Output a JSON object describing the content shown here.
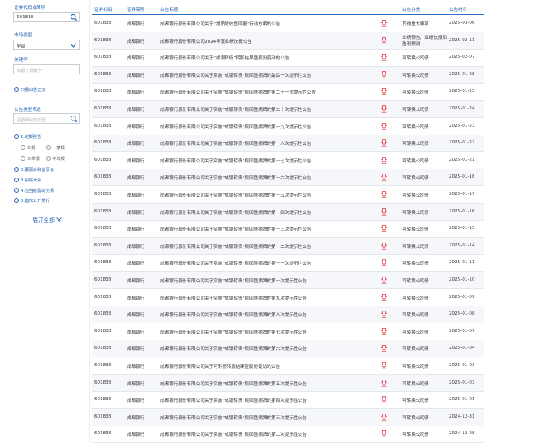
{
  "filters": {
    "code_label": "证券代码或简称",
    "code_value": "601838",
    "market_label": "市场类型",
    "market_value": "全部",
    "keyword_label": "关键字",
    "keyword_placeholder": "标题 / 关键字",
    "only_body_label": "只看公告正文",
    "category_label": "公告类型筛选",
    "category_placeholder": "请选择公告类型",
    "categories": [
      {
        "label": "1.定期报告"
      },
      {
        "label": "2.董事会和监事会"
      },
      {
        "label": "3.股东大会"
      },
      {
        "label": "4.应当披露的交易"
      },
      {
        "label": "5.首次公开发行"
      }
    ],
    "periodic_sub": [
      "年报",
      "一季报",
      "三季报",
      "半年报"
    ],
    "expand_label": "展开全部"
  },
  "table": {
    "headers": [
      "证券代码",
      "证券简称",
      "公告标题",
      "公告分类",
      "公告时间"
    ],
    "rows": [
      {
        "code": "601838",
        "name": "成都银行",
        "title": "成都银行股份有限公司关于“提质增效重回报”行动方案的公告",
        "type": "其他重大事项",
        "date": "2025-03-06"
      },
      {
        "code": "601838",
        "name": "成都银行",
        "title": "成都银行股份有限公司2024年度业绩快报公告",
        "type": "业绩预告、业绩快报和盈利预测",
        "date": "2025-02-11"
      },
      {
        "code": "601838",
        "name": "成都银行",
        "title": "成都银行股份有限公司关于“成银转债”转股结果暨股份变动的公告",
        "type": "可转换公司债",
        "date": "2025-02-07"
      },
      {
        "code": "601838",
        "name": "成都银行",
        "title": "成都银行股份有限公司关于实施“成银转债”赎回暨摘牌的最后一次提示性公告",
        "type": "可转换公司债",
        "date": "2025-01-28"
      },
      {
        "code": "601838",
        "name": "成都银行",
        "title": "成都银行股份有限公司关于实施“成银转债”赎回暨摘牌的第二十一次提示性公告",
        "type": "可转换公司债",
        "date": "2025-01-25"
      },
      {
        "code": "601838",
        "name": "成都银行",
        "title": "成都银行股份有限公司关于实施“成银转债”赎回暨摘牌的第二十次提示性公告",
        "type": "可转换公司债",
        "date": "2025-01-24"
      },
      {
        "code": "601838",
        "name": "成都银行",
        "title": "成都银行股份有限公司关于实施“成银转债”赎回暨摘牌的第十九次提示性公告",
        "type": "可转换公司债",
        "date": "2025-01-23"
      },
      {
        "code": "601838",
        "name": "成都银行",
        "title": "成都银行股份有限公司关于实施“成银转债”赎回暨摘牌的第十八次提示性公告",
        "type": "可转换公司债",
        "date": "2025-01-22"
      },
      {
        "code": "601838",
        "name": "成都银行",
        "title": "成都银行股份有限公司关于实施“成银转债”赎回暨摘牌的第十七次提示性公告",
        "type": "可转换公司债",
        "date": "2025-01-21"
      },
      {
        "code": "601838",
        "name": "成都银行",
        "title": "成都银行股份有限公司关于实施“成银转债”赎回暨摘牌的第十六次提示性公告",
        "type": "可转换公司债",
        "date": "2025-01-18"
      },
      {
        "code": "601838",
        "name": "成都银行",
        "title": "成都银行股份有限公司关于实施“成银转债”赎回暨摘牌的第十五次提示性公告",
        "type": "可转换公司债",
        "date": "2025-01-17"
      },
      {
        "code": "601838",
        "name": "成都银行",
        "title": "成都银行股份有限公司关于实施“成银转债”赎回暨摘牌的第十四次提示性公告",
        "type": "可转换公司债",
        "date": "2025-01-16"
      },
      {
        "code": "601838",
        "name": "成都银行",
        "title": "成都银行股份有限公司关于实施“成银转债”赎回暨摘牌的第十三次提示性公告",
        "type": "可转换公司债",
        "date": "2025-01-15"
      },
      {
        "code": "601838",
        "name": "成都银行",
        "title": "成都银行股份有限公司关于实施“成银转债”赎回暨摘牌的第十二次提示性公告",
        "type": "可转换公司债",
        "date": "2025-01-14"
      },
      {
        "code": "601838",
        "name": "成都银行",
        "title": "成都银行股份有限公司关于实施“成银转债”赎回暨摘牌的第十一次提示性公告",
        "type": "可转换公司债",
        "date": "2025-01-11"
      },
      {
        "code": "601838",
        "name": "成都银行",
        "title": "成都银行股份有限公司关于实施“成银转债”赎回暨摘牌的第十次提示性公告",
        "type": "可转换公司债",
        "date": "2025-01-10"
      },
      {
        "code": "601838",
        "name": "成都银行",
        "title": "成都银行股份有限公司关于实施“成银转债”赎回暨摘牌的第九次提示性公告",
        "type": "可转换公司债",
        "date": "2025-01-09"
      },
      {
        "code": "601838",
        "name": "成都银行",
        "title": "成都银行股份有限公司关于实施“成银转债”赎回暨摘牌的第八次提示性公告",
        "type": "可转换公司债",
        "date": "2025-01-08"
      },
      {
        "code": "601838",
        "name": "成都银行",
        "title": "成都银行股份有限公司关于实施“成银转债”赎回暨摘牌的第七次提示性公告",
        "type": "可转换公司债",
        "date": "2025-01-07"
      },
      {
        "code": "601838",
        "name": "成都银行",
        "title": "成都银行股份有限公司关于实施“成银转债”赎回暨摘牌的第六次提示性公告",
        "type": "可转换公司债",
        "date": "2025-01-04"
      },
      {
        "code": "601838",
        "name": "成都银行",
        "title": "成都银行股份有限公司关于可转债转股结果暨股份变动的公告",
        "type": "可转换公司债",
        "date": "2025-01-03"
      },
      {
        "code": "601838",
        "name": "成都银行",
        "title": "成都银行股份有限公司关于实施“成银转债”赎回暨摘牌的第五次提示性公告",
        "type": "可转换公司债",
        "date": "2025-01-03"
      },
      {
        "code": "601838",
        "name": "成都银行",
        "title": "成都银行股份有限公司关于实施“成银转债”赎回暨摘牌的第四次提示性公告",
        "type": "可转换公司债",
        "date": "2025-01-01"
      },
      {
        "code": "601838",
        "name": "成都银行",
        "title": "成都银行股份有限公司关于实施“成银转债”赎回暨摘牌的第三次提示性公告",
        "type": "可转换公司债",
        "date": "2024-12-31"
      },
      {
        "code": "601838",
        "name": "成都银行",
        "title": "成都银行股份有限公司关于实施“成银转债”赎回暨摘牌的第二次提示性公告",
        "type": "可转换公司债",
        "date": "2024-12-28"
      }
    ]
  },
  "colors": {
    "accent": "#2463b0",
    "download_icon": "#e4393c"
  }
}
